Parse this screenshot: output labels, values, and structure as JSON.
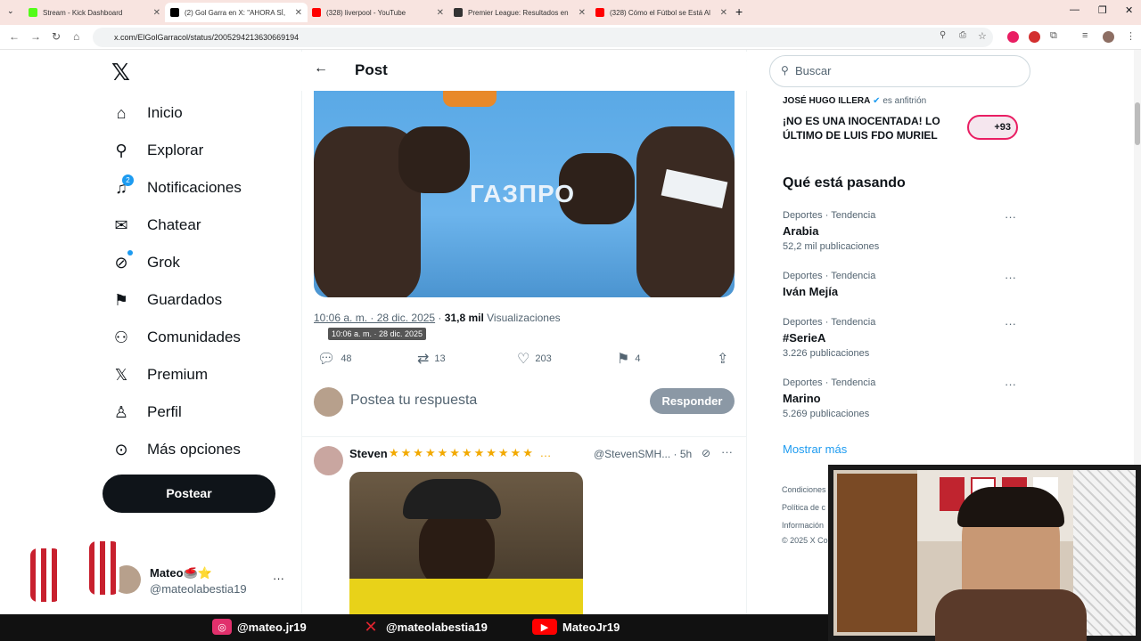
{
  "browser": {
    "tabs": [
      {
        "title": "Stream - Kick Dashboard",
        "color": "#53fc18"
      },
      {
        "title": "(2) Gol Garra en X: \"AHORA SÍ,",
        "color": "#000000"
      },
      {
        "title": "(328) liverpool - YouTube",
        "color": "#ff0000"
      },
      {
        "title": "Premier League: Resultados en",
        "color": "#333333"
      },
      {
        "title": "(328) Cómo el Fútbol se Está Al",
        "color": "#ff0000"
      }
    ],
    "url": "x.com/ElGolGarracol/status/2005294213630669194"
  },
  "sidebar": {
    "items": [
      {
        "label": "Inicio",
        "icon": "home-icon",
        "glyph": "⌂"
      },
      {
        "label": "Explorar",
        "icon": "search-icon",
        "glyph": "⚲"
      },
      {
        "label": "Notificaciones",
        "icon": "bell-icon",
        "glyph": "🔔"
      },
      {
        "label": "Chatear",
        "icon": "mail-icon",
        "glyph": "✉"
      },
      {
        "label": "Grok",
        "icon": "grok-icon",
        "glyph": "⊘"
      },
      {
        "label": "Guardados",
        "icon": "bookmark-icon",
        "glyph": "⎕"
      },
      {
        "label": "Comunidades",
        "icon": "people-icon",
        "glyph": "👥"
      },
      {
        "label": "Premium",
        "icon": "x-icon",
        "glyph": "𝕏"
      },
      {
        "label": "Perfil",
        "icon": "person-icon",
        "glyph": "⚇"
      },
      {
        "label": "Más opciones",
        "icon": "more-circle-icon",
        "glyph": "⋯"
      }
    ],
    "notif_badge": "2",
    "post_button": "Postear",
    "user_name": "Mateo🥌⭐",
    "user_handle": "@mateolabestia19"
  },
  "post": {
    "header": "Post",
    "photo_text": "ГАЗПРО",
    "time": "10:06 a. m. · 28 dic. 2025",
    "views_count": "31,8 mil",
    "views_label": "Visualizaciones",
    "tooltip": "10:06 a. m. · 28 dic. 2025",
    "replies": "48",
    "reposts": "13",
    "likes": "203",
    "bookmarks": "4",
    "reply_placeholder": "Postea tu respuesta",
    "reply_button": "Responder"
  },
  "reply": {
    "name": "Steven",
    "stars": "★★★★★★★★★★★★ …",
    "handle": "@StevenSMH... · 5h"
  },
  "right": {
    "search_placeholder": "Buscar",
    "space_host": "JOSÉ HUGO ILLERA",
    "space_host_role": "es anfitrión",
    "space_title": "¡NO ES UNA INOCENTADA! LO ÚLTIMO DE LUIS FDO MURIEL",
    "space_count": "+93",
    "trending_title": "Qué está pasando",
    "trends": [
      {
        "category": "Deportes · Tendencia",
        "name": "Arabia",
        "count": "52,2 mil publicaciones"
      },
      {
        "category": "Deportes · Tendencia",
        "name": "Iván Mejía",
        "count": ""
      },
      {
        "category": "Deportes · Tendencia",
        "name": "#SerieA",
        "count": "3.226 publicaciones"
      },
      {
        "category": "Deportes · Tendencia",
        "name": "Marino",
        "count": "5.269 publicaciones"
      }
    ],
    "show_more": "Mostrar más",
    "footer": [
      "Condiciones",
      "Política de c",
      "Información",
      "© 2025 X Co"
    ]
  },
  "overlay": {
    "instagram": "@mateo.jr19",
    "x": "@mateolabestia19",
    "youtube": "MateoJr19"
  }
}
